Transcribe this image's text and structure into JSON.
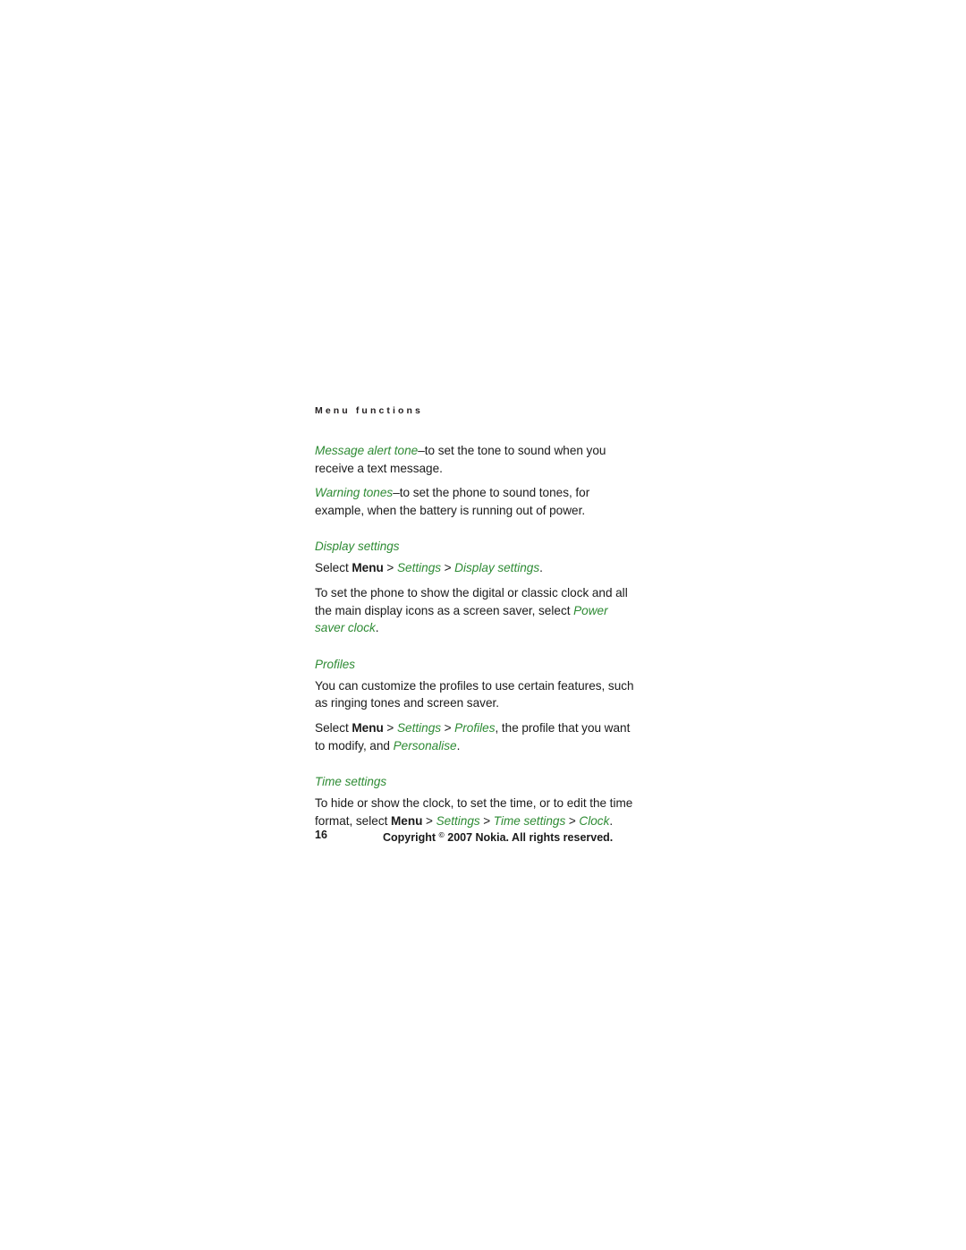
{
  "page": {
    "running_head": "Menu functions",
    "number": "16",
    "accent_color": "#2e8b34",
    "text_color": "#1a1a1a",
    "background_color": "#ffffff"
  },
  "intro": {
    "message_alert": {
      "term": "Message alert tone",
      "dash": "–",
      "text": "to set the tone to sound when you receive a text message."
    },
    "warning_tones": {
      "term": "Warning tones",
      "dash": "–",
      "text": "to set the phone to sound tones, for example, when the battery is running out of power."
    }
  },
  "sections": [
    {
      "heading": "Display settings",
      "select_line": {
        "lead": "Select ",
        "menu": "Menu",
        "sep": " > ",
        "crumb1": "Settings",
        "crumb2": "Display settings",
        "end": "."
      },
      "body_prefix": "To set the phone to show the digital or classic clock and all the main display icons as a screen saver, select ",
      "body_term": "Power saver clock",
      "body_suffix": "."
    },
    {
      "heading": "Profiles",
      "body": "You can customize the profiles to use certain features, such as ringing tones and screen saver.",
      "select_line": {
        "lead": "Select ",
        "menu": "Menu",
        "sep": " > ",
        "crumb1": "Settings",
        "crumb2": "Profiles",
        "mid": ", the profile that you want to modify, and ",
        "crumb3": "Personalise",
        "end": "."
      }
    },
    {
      "heading": "Time settings",
      "body_prefix": "To hide or show the clock, to set the time, or to edit the time format, select ",
      "select_line": {
        "menu": "Menu",
        "sep": " > ",
        "crumb1": "Settings",
        "crumb2": "Time settings",
        "crumb3": "Clock",
        "end": "."
      }
    }
  ],
  "footer": {
    "page_number": "16",
    "copyright_word": "Copyright ",
    "copyright_symbol": "©",
    "copyright_rest": " 2007 Nokia. All rights reserved."
  }
}
